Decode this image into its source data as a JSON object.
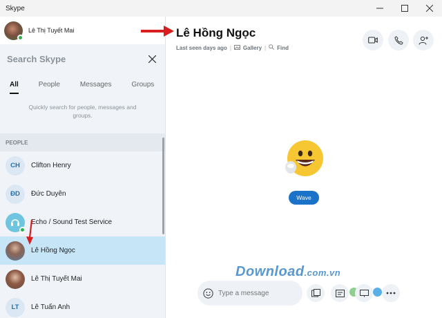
{
  "window": {
    "title": "Skype",
    "controls": [
      "minimize",
      "maximize",
      "close"
    ]
  },
  "profile": {
    "name": "Lê Thị Tuyết Mai",
    "status_color": "#2ab24c"
  },
  "search": {
    "title": "Search Skype",
    "close_icon": "close-icon"
  },
  "tabs": [
    {
      "label": "All",
      "active": true
    },
    {
      "label": "People",
      "active": false
    },
    {
      "label": "Messages",
      "active": false
    },
    {
      "label": "Groups",
      "active": false
    }
  ],
  "hint": "Quickly search for people, messages and groups.",
  "section": {
    "label": "PEOPLE"
  },
  "contacts": [
    {
      "initials": "CH",
      "name": "Clifton Henry",
      "selected": false,
      "avatar": "initials"
    },
    {
      "initials": "ĐD",
      "name": "Đức Duyên",
      "selected": false,
      "avatar": "initials"
    },
    {
      "initials": "",
      "name": "Echo / Sound Test Service",
      "selected": false,
      "avatar": "headset-icon"
    },
    {
      "initials": "",
      "name": "Lê Hồng Ngọc",
      "selected": true,
      "avatar": "photo"
    },
    {
      "initials": "",
      "name": "Lê Thị Tuyết Mai",
      "selected": false,
      "avatar": "photo"
    },
    {
      "initials": "LT",
      "name": "Lê Tuấn Anh",
      "selected": false,
      "avatar": "initials"
    }
  ],
  "chat": {
    "contact_name": "Lê Hồng Ngọc",
    "last_seen": "Last seen days ago",
    "gallery_label": "Gallery",
    "find_label": "Find",
    "wave_label": "Wave",
    "message_placeholder": "Type a message"
  },
  "watermark": {
    "text": "Download",
    "suffix": ".com.vn"
  },
  "colors": {
    "accent": "#1a73c8",
    "selected_row": "#c6e6f8",
    "annotation_arrow": "#d81e1e"
  }
}
